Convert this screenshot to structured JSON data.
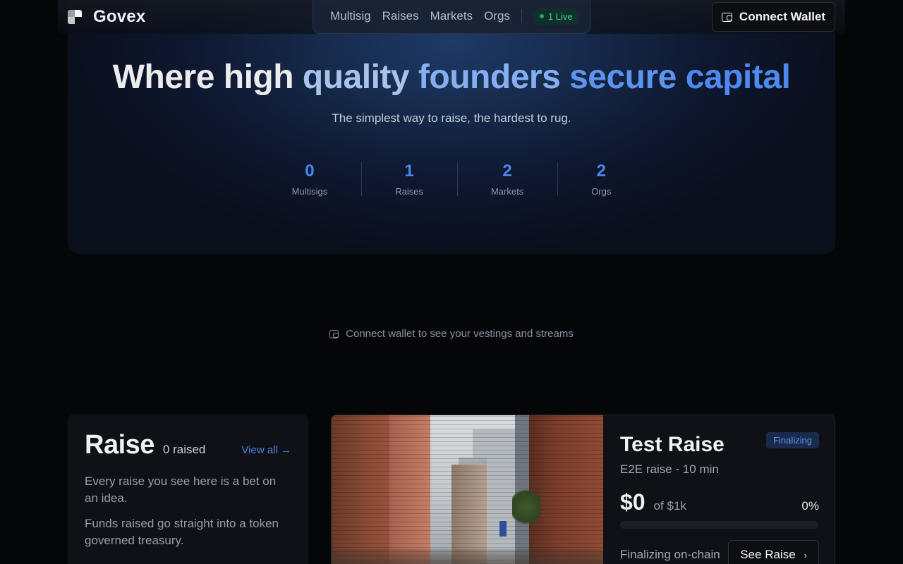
{
  "brand": {
    "name": "Govex"
  },
  "nav": {
    "items": [
      "Multisig",
      "Raises",
      "Markets",
      "Orgs"
    ],
    "live_badge": "1 Live"
  },
  "header": {
    "connect_wallet_label": "Connect Wallet"
  },
  "hero": {
    "title_parts": [
      "Where high ",
      "quality ",
      "founders ",
      "secure ",
      "capital"
    ],
    "subtitle": "The simplest way to raise, the hardest to rug.",
    "stats": [
      {
        "value": "0",
        "label": "Multisigs"
      },
      {
        "value": "1",
        "label": "Raises"
      },
      {
        "value": "2",
        "label": "Markets"
      },
      {
        "value": "2",
        "label": "Orgs"
      }
    ]
  },
  "wallet_prompt": "Connect wallet to see your vestings and streams",
  "raise_section": {
    "title": "Raise",
    "raised": "0 raised",
    "view_all": "View all →",
    "desc1": "Every raise you see here is a bet on an idea.",
    "desc2": "Funds raised go straight into a token governed treasury."
  },
  "raise_card": {
    "status": "Finalizing",
    "title": "Test Raise",
    "subtitle": "E2E raise - 10 min",
    "amount": "$0",
    "goal": "of $1k",
    "percent": "0%",
    "progress_fraction": 0,
    "footer_status": "Finalizing on-chain",
    "cta": "See Raise",
    "cta_icon": "chevron-right-icon"
  },
  "colors": {
    "accent": "#4b86ea",
    "live_green": "#3ccf8a",
    "background": "#050608"
  }
}
